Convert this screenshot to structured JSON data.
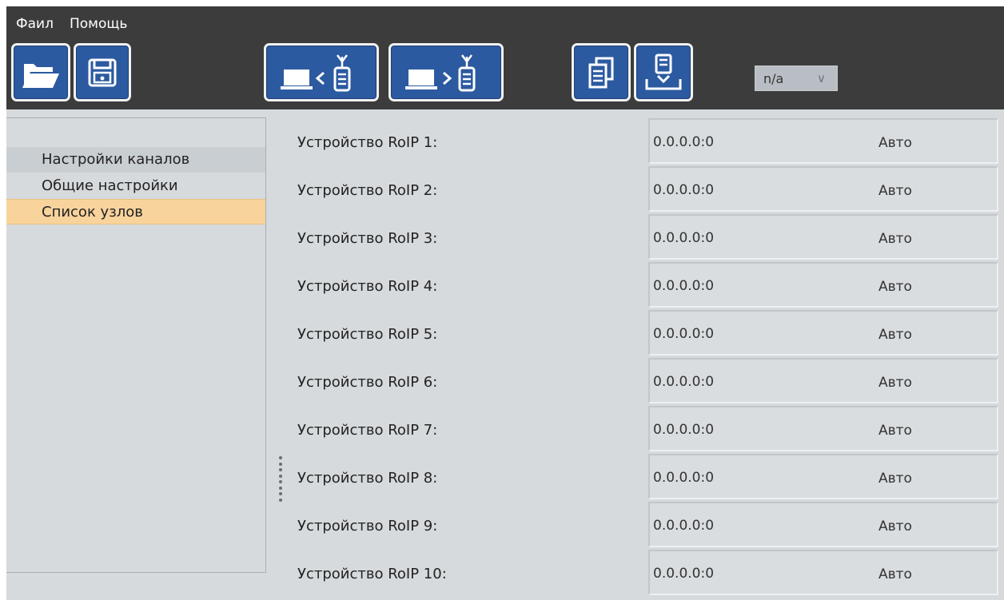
{
  "menu": {
    "file_label": "Фаил",
    "help_label": "Помощь"
  },
  "toolbar": {
    "open_icon": "folder-open-icon",
    "save_icon": "floppy-disk-icon",
    "download_icon": "computer-from-device-icon",
    "upload_icon": "computer-to-device-icon",
    "copy_icon": "copy-document-icon",
    "install_icon": "install-to-tray-icon",
    "accent_color": "#2c5aa0",
    "device_select": {
      "value": "n/a"
    }
  },
  "sidebar": {
    "items": [
      {
        "label": "Настройки каналов"
      },
      {
        "label": "Общие настройки"
      },
      {
        "label": "Список узлов"
      }
    ],
    "active_color": "#f8d39c"
  },
  "devices": [
    {
      "label": "Устройство RoIP 1:",
      "address": "0.0.0.0:0",
      "mode": "Авто"
    },
    {
      "label": "Устройство RoIP 2:",
      "address": "0.0.0.0:0",
      "mode": "Авто"
    },
    {
      "label": "Устройство RoIP 3:",
      "address": "0.0.0.0:0",
      "mode": "Авто"
    },
    {
      "label": "Устройство RoIP 4:",
      "address": "0.0.0.0:0",
      "mode": "Авто"
    },
    {
      "label": "Устройство RoIP 5:",
      "address": "0.0.0.0:0",
      "mode": "Авто"
    },
    {
      "label": "Устройство RoIP 6:",
      "address": "0.0.0.0:0",
      "mode": "Авто"
    },
    {
      "label": "Устройство RoIP 7:",
      "address": "0.0.0.0:0",
      "mode": "Авто"
    },
    {
      "label": "Устройство RoIP 8:",
      "address": "0.0.0.0:0",
      "mode": "Авто"
    },
    {
      "label": "Устройство RoIP 9:",
      "address": "0.0.0.0:0",
      "mode": "Авто"
    },
    {
      "label": "Устройство RoIP 10:",
      "address": "0.0.0.0:0",
      "mode": "Авто"
    }
  ]
}
